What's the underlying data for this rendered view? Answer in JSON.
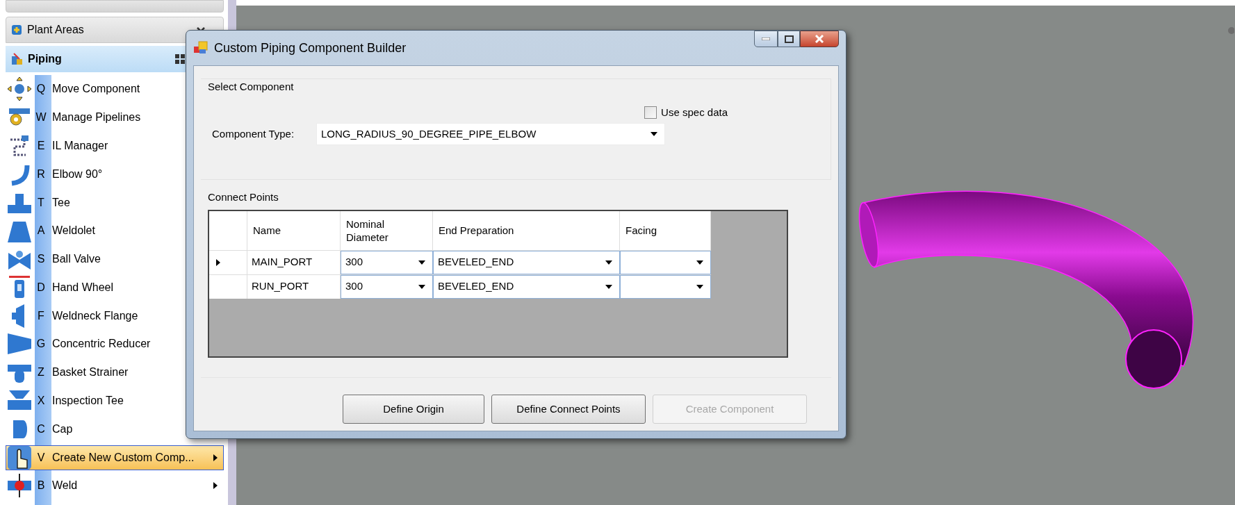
{
  "sidebar": {
    "collapsed_panel": {
      "title": "Plant Areas",
      "expanded": false
    },
    "piping_panel": {
      "title": "Piping",
      "items": [
        {
          "key": "Q",
          "label": "Move Component",
          "selected": false
        },
        {
          "key": "W",
          "label": "Manage Pipelines",
          "selected": false
        },
        {
          "key": "E",
          "label": "IL Manager",
          "selected": false
        },
        {
          "key": "R",
          "label": "Elbow 90°",
          "selected": false
        },
        {
          "key": "T",
          "label": "Tee",
          "selected": false
        },
        {
          "key": "A",
          "label": "Weldolet",
          "selected": false
        },
        {
          "key": "S",
          "label": "Ball Valve",
          "selected": false
        },
        {
          "key": "D",
          "label": "Hand Wheel",
          "selected": false
        },
        {
          "key": "F",
          "label": "Weldneck Flange",
          "selected": false
        },
        {
          "key": "G",
          "label": "Concentric Reducer",
          "selected": false
        },
        {
          "key": "Z",
          "label": "Basket Strainer",
          "selected": false
        },
        {
          "key": "X",
          "label": "Inspection Tee",
          "selected": false
        },
        {
          "key": "C",
          "label": "Cap",
          "selected": false
        },
        {
          "key": "V",
          "label": "Create New Custom Comp...",
          "selected": true,
          "submenu": true
        },
        {
          "key": "B",
          "label": "Weld",
          "selected": false,
          "submenu": true
        }
      ]
    }
  },
  "dialog": {
    "title": "Custom Piping Component Builder",
    "select_component": {
      "title": "Select Component",
      "use_spec_data": {
        "label": "Use spec data",
        "checked": false
      },
      "component_type": {
        "label": "Component Type:",
        "value": "LONG_RADIUS_90_DEGREE_PIPE_ELBOW"
      }
    },
    "connect_points": {
      "title": "Connect Points",
      "columns": [
        "Name",
        "Nominal Diameter",
        "End Preparation",
        "Facing"
      ],
      "rows": [
        {
          "selected": true,
          "name": "MAIN_PORT",
          "nominal_diameter": "300",
          "end_preparation": "BEVELED_END"
        },
        {
          "selected": false,
          "name": "RUN_PORT",
          "nominal_diameter": "300",
          "end_preparation": "BEVELED_END"
        }
      ]
    },
    "buttons": [
      {
        "label": "Define Origin",
        "disabled": false
      },
      {
        "label": "Define Connect Points",
        "disabled": false
      },
      {
        "label": "Create Component",
        "disabled": true
      }
    ]
  }
}
